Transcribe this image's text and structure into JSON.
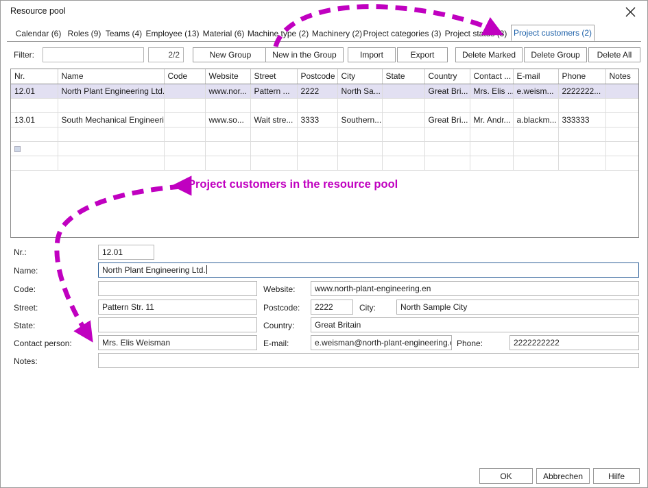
{
  "window": {
    "title": "Resource pool",
    "close_icon": "close-icon"
  },
  "tabs": [
    {
      "label": "Calendar (6)",
      "active": false
    },
    {
      "label": "Roles (9)",
      "active": false
    },
    {
      "label": "Teams (4)",
      "active": false
    },
    {
      "label": "Employee (13)",
      "active": false
    },
    {
      "label": "Material (6)",
      "active": false
    },
    {
      "label": "Machine type (2)",
      "active": false
    },
    {
      "label": "Machinery (2)",
      "active": false
    },
    {
      "label": "Project categories (3)",
      "active": false
    },
    {
      "label": "Project status (3)",
      "active": false
    },
    {
      "label": "Project customers (2)",
      "active": true
    }
  ],
  "toolbar": {
    "filter_label": "Filter:",
    "filter_value": "",
    "filter_placeholder": "",
    "count": "2/2",
    "new_group": "New Group",
    "new_in_group": "New in the Group",
    "import": "Import",
    "export": "Export",
    "delete_marked": "Delete Marked",
    "delete_group": "Delete Group",
    "delete_all": "Delete All"
  },
  "grid": {
    "columns": [
      "Nr.",
      "Name",
      "Code",
      "Website",
      "Street",
      "Postcode",
      "City",
      "State",
      "Country",
      "Contact ...",
      "E-mail",
      "Phone",
      "Notes"
    ],
    "rows": [
      {
        "selected": true,
        "cells": [
          "12.01",
          "North Plant Engineering Ltd.",
          "",
          "www.nor...",
          "Pattern ...",
          "2222",
          "North Sa...",
          "",
          "Great Bri...",
          "Mrs. Elis ...",
          "e.weism...",
          "2222222...",
          ""
        ]
      },
      {
        "selected": false,
        "cells": [
          "",
          "",
          "",
          "",
          "",
          "",
          "",
          "",
          "",
          "",
          "",
          "",
          ""
        ]
      },
      {
        "selected": false,
        "cells": [
          "13.01",
          "South Mechanical Engineerin...",
          "",
          "www.so...",
          "Wait stre...",
          "3333",
          "Southern...",
          "",
          "Great Bri...",
          "Mr. Andr...",
          "a.blackm...",
          "333333",
          ""
        ]
      },
      {
        "selected": false,
        "cells": [
          "",
          "",
          "",
          "",
          "",
          "",
          "",
          "",
          "",
          "",
          "",
          "",
          ""
        ]
      },
      {
        "selected": false,
        "new_row_marker": true,
        "cells": [
          "",
          "",
          "",
          "",
          "",
          "",
          "",
          "",
          "",
          "",
          "",
          "",
          ""
        ]
      },
      {
        "selected": false,
        "cells": [
          "",
          "",
          "",
          "",
          "",
          "",
          "",
          "",
          "",
          "",
          "",
          "",
          ""
        ]
      }
    ]
  },
  "form": {
    "nr_label": "Nr.:",
    "nr_value": "12.01",
    "name_label": "Name:",
    "name_value": "North Plant Engineering Ltd.",
    "code_label": "Code:",
    "code_value": "",
    "website_label": "Website:",
    "website_value": "www.north-plant-engineering.en",
    "street_label": "Street:",
    "street_value": "Pattern Str. 11",
    "postcode_label": "Postcode:",
    "postcode_value": "2222",
    "city_label": "City:",
    "city_value": "North Sample City",
    "state_label": "State:",
    "state_value": "",
    "country_label": "Country:",
    "country_value": "Great Britain",
    "contact_label": "Contact person:",
    "contact_value": "Mrs. Elis Weisman",
    "email_label": "E-mail:",
    "email_value": "e.weisman@north-plant-engineering.en",
    "phone_label": "Phone:",
    "phone_value": "2222222222",
    "notes_label": "Notes:",
    "notes_value": ""
  },
  "bottom": {
    "ok": "OK",
    "cancel": "Abbrechen",
    "help": "Hilfe"
  },
  "annotation": {
    "text": "Project customers in the resource pool",
    "color": "#c000c0"
  }
}
